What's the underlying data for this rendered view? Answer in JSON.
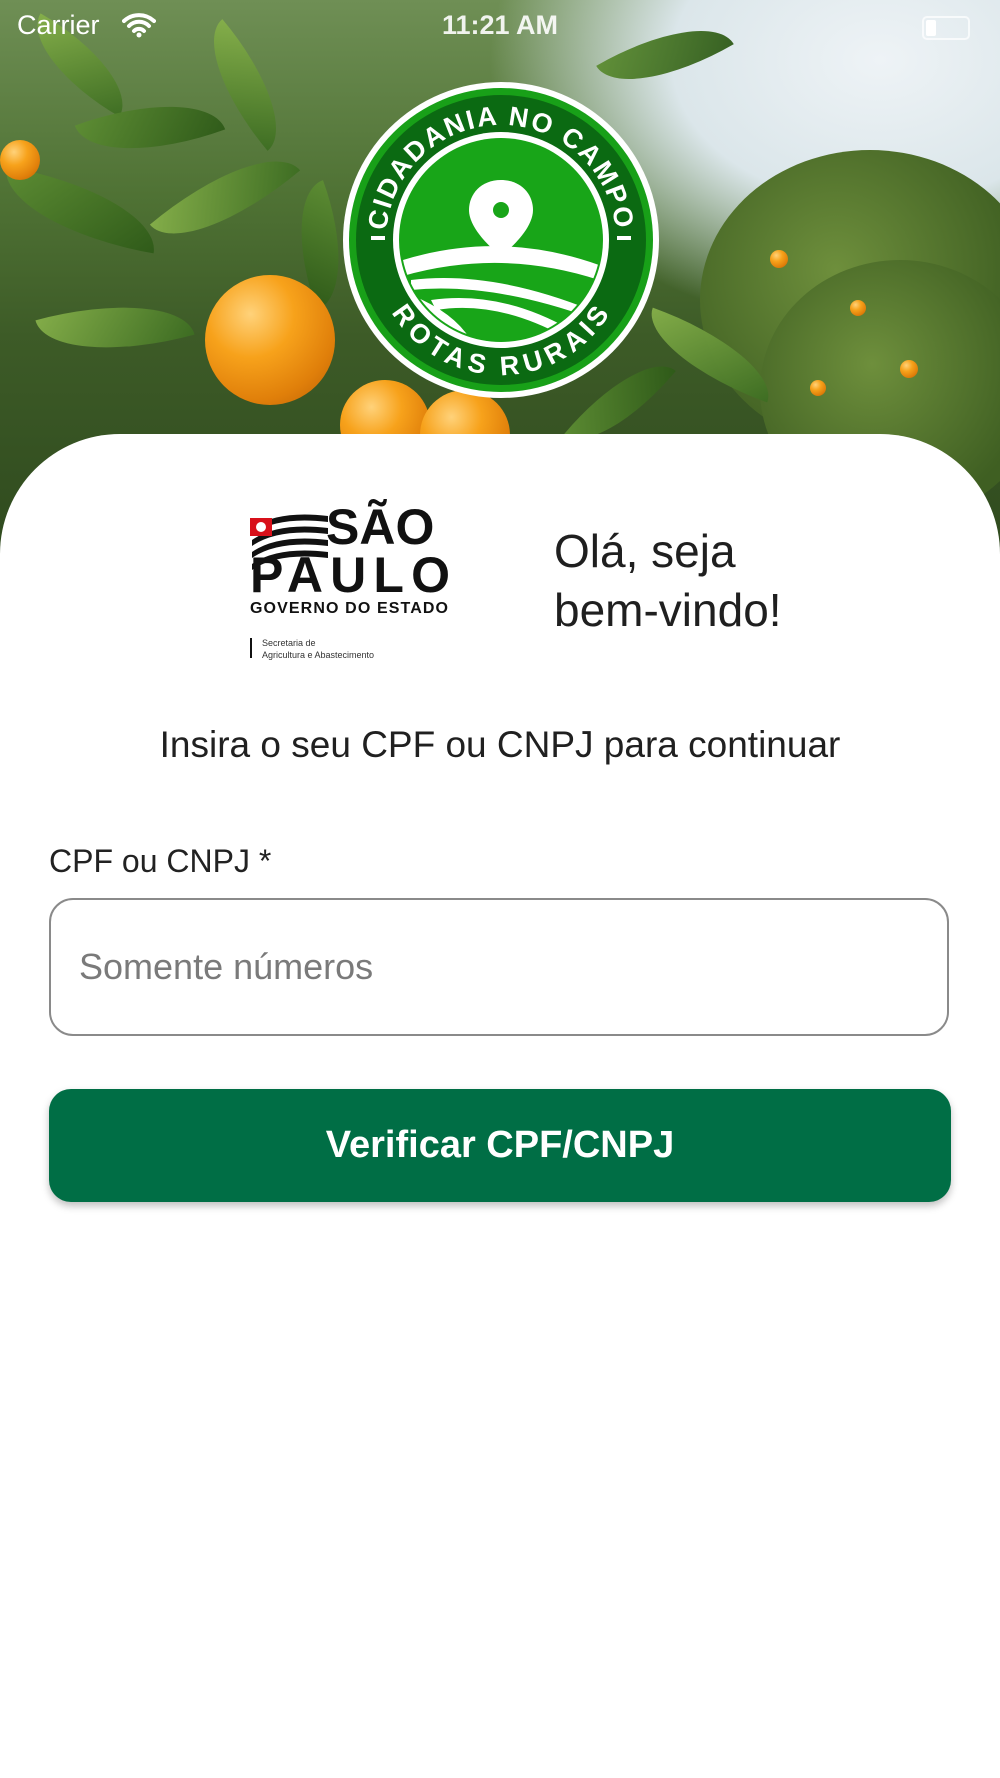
{
  "status_bar": {
    "carrier": "Carrier",
    "time": "11:21 AM"
  },
  "emblem": {
    "top_text": "CIDADANIA NO CAMPO",
    "bottom_text": "ROTAS RURAIS"
  },
  "gov_logo": {
    "line1": "SÃO",
    "line2": "PAULO",
    "line3": "GOVERNO DO ESTADO",
    "line4": "Secretaria de",
    "line5": "Agricultura e Abastecimento"
  },
  "welcome": {
    "line1": "Olá, seja",
    "line2": "bem-vindo!"
  },
  "subtitle": "Insira o seu CPF ou CNPJ para continuar",
  "form": {
    "label": "CPF ou CNPJ *",
    "placeholder": "Somente números",
    "value": "",
    "submit_label": "Verificar CPF/CNPJ"
  },
  "colors": {
    "primary": "#006e45",
    "emblem_green": "#1aa51a",
    "emblem_dark": "#0b6a12"
  }
}
